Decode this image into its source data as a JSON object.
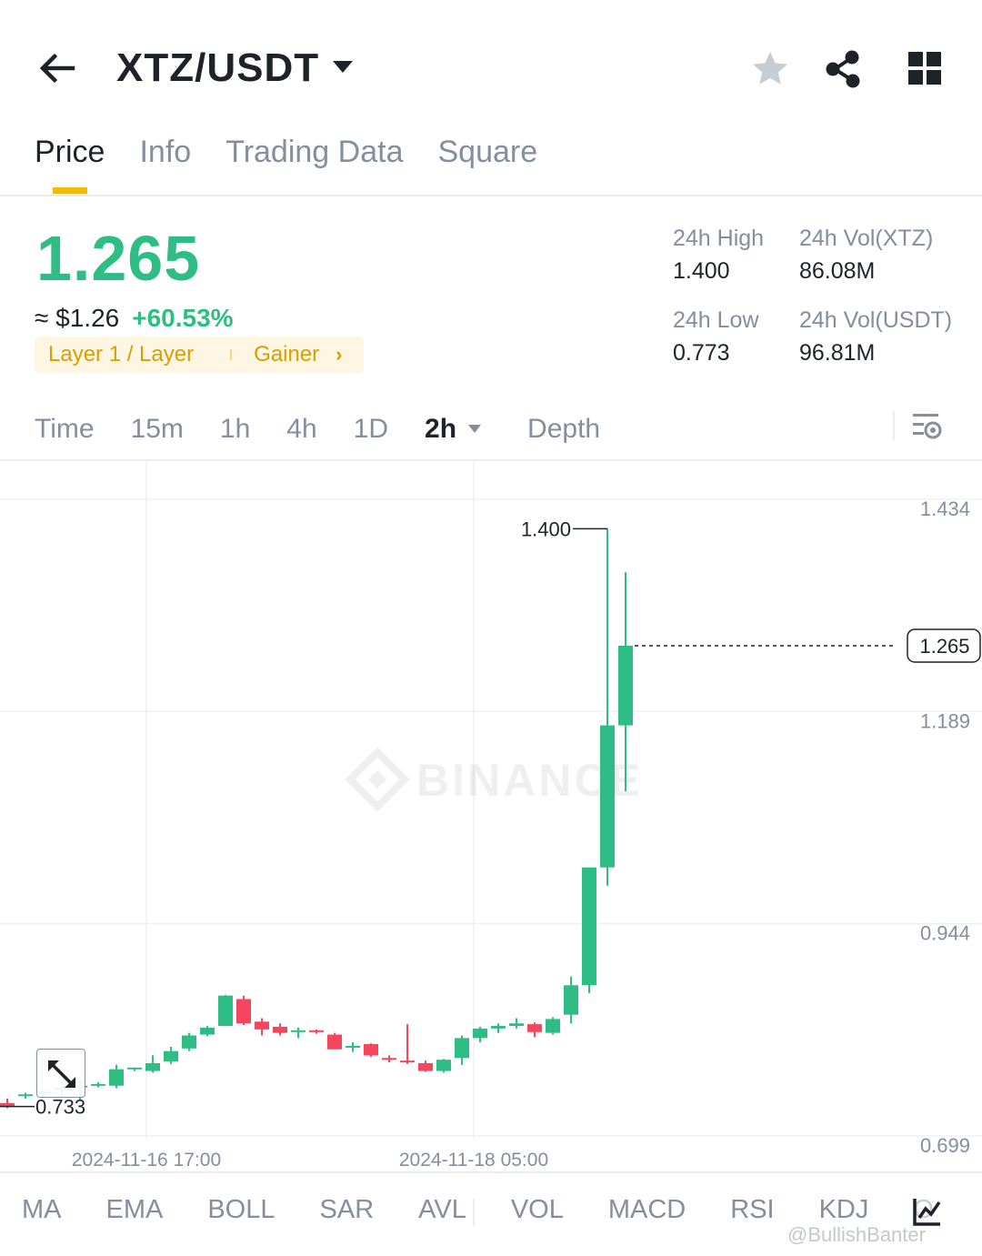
{
  "header": {
    "pair": "XTZ/USDT"
  },
  "tabs": [
    {
      "label": "Price"
    },
    {
      "label": "Info"
    },
    {
      "label": "Trading Data"
    },
    {
      "label": "Square"
    }
  ],
  "ticker": {
    "last_price": "1.265",
    "fiat_price": "≈ $1.26",
    "change": "+60.53%",
    "tag": "Layer 1 / Layer",
    "tag2": "Gainer",
    "high_label": "24h High",
    "high_value": "1.400",
    "low_label": "24h Low",
    "low_value": "0.773",
    "vol_base_label": "24h Vol(XTZ)",
    "vol_base_value": "86.08M",
    "vol_quote_label": "24h Vol(USDT)",
    "vol_quote_value": "96.81M"
  },
  "intervals": [
    {
      "label": "Time"
    },
    {
      "label": "15m"
    },
    {
      "label": "1h"
    },
    {
      "label": "4h"
    },
    {
      "label": "1D"
    },
    {
      "label": "2h",
      "active": true
    },
    {
      "label": "Depth"
    }
  ],
  "indicators": [
    "MA",
    "EMA",
    "BOLL",
    "SAR",
    "AVL",
    "VOL",
    "MACD",
    "RSI",
    "KDJ",
    "O"
  ],
  "watermark": {
    "brand": "BINANCE",
    "handle": "@BullishBanter"
  },
  "colors": {
    "up": "#2ebd85",
    "down": "#f6465d",
    "accent": "#f0b90b",
    "muted": "#848e9c"
  },
  "chart_data": {
    "type": "candlestick",
    "y_ticks": [
      "1.434",
      "1.189",
      "0.944",
      "0.699"
    ],
    "x_ticks": [
      "2024-11-16 17:00",
      "2024-11-18 05:00"
    ],
    "ylim": [
      0.699,
      1.434
    ],
    "current_price": "1.265",
    "max_label": "1.400",
    "min_label": "0.733",
    "candles": [
      {
        "o": 0.737,
        "h": 0.742,
        "l": 0.731,
        "c": 0.733
      },
      {
        "o": 0.745,
        "h": 0.749,
        "l": 0.742,
        "c": 0.747
      },
      {
        "o": 0.748,
        "h": 0.753,
        "l": 0.744,
        "c": 0.751
      },
      {
        "o": 0.752,
        "h": 0.756,
        "l": 0.744,
        "c": 0.755
      },
      {
        "o": 0.756,
        "h": 0.763,
        "l": 0.741,
        "c": 0.757
      },
      {
        "o": 0.759,
        "h": 0.761,
        "l": 0.755,
        "c": 0.759
      },
      {
        "o": 0.757,
        "h": 0.781,
        "l": 0.754,
        "c": 0.776
      },
      {
        "o": 0.776,
        "h": 0.778,
        "l": 0.774,
        "c": 0.778
      },
      {
        "o": 0.774,
        "h": 0.792,
        "l": 0.772,
        "c": 0.783
      },
      {
        "o": 0.785,
        "h": 0.802,
        "l": 0.782,
        "c": 0.797
      },
      {
        "o": 0.8,
        "h": 0.818,
        "l": 0.797,
        "c": 0.815
      },
      {
        "o": 0.816,
        "h": 0.826,
        "l": 0.814,
        "c": 0.824
      },
      {
        "o": 0.826,
        "h": 0.862,
        "l": 0.826,
        "c": 0.861
      },
      {
        "o": 0.857,
        "h": 0.861,
        "l": 0.827,
        "c": 0.829
      },
      {
        "o": 0.831,
        "h": 0.835,
        "l": 0.815,
        "c": 0.822
      },
      {
        "o": 0.825,
        "h": 0.829,
        "l": 0.815,
        "c": 0.818
      },
      {
        "o": 0.82,
        "h": 0.824,
        "l": 0.812,
        "c": 0.821
      },
      {
        "o": 0.821,
        "h": 0.822,
        "l": 0.817,
        "c": 0.819
      },
      {
        "o": 0.816,
        "h": 0.818,
        "l": 0.799,
        "c": 0.799
      },
      {
        "o": 0.802,
        "h": 0.807,
        "l": 0.796,
        "c": 0.803
      },
      {
        "o": 0.805,
        "h": 0.806,
        "l": 0.79,
        "c": 0.792
      },
      {
        "o": 0.789,
        "h": 0.792,
        "l": 0.784,
        "c": 0.787
      },
      {
        "o": 0.786,
        "h": 0.828,
        "l": 0.782,
        "c": 0.784
      },
      {
        "o": 0.783,
        "h": 0.786,
        "l": 0.773,
        "c": 0.774
      },
      {
        "o": 0.774,
        "h": 0.788,
        "l": 0.772,
        "c": 0.787
      },
      {
        "o": 0.789,
        "h": 0.815,
        "l": 0.781,
        "c": 0.812
      },
      {
        "o": 0.812,
        "h": 0.825,
        "l": 0.807,
        "c": 0.823
      },
      {
        "o": 0.823,
        "h": 0.829,
        "l": 0.818,
        "c": 0.826
      },
      {
        "o": 0.826,
        "h": 0.835,
        "l": 0.823,
        "c": 0.829
      },
      {
        "o": 0.828,
        "h": 0.83,
        "l": 0.813,
        "c": 0.819
      },
      {
        "o": 0.818,
        "h": 0.836,
        "l": 0.816,
        "c": 0.834
      },
      {
        "o": 0.839,
        "h": 0.883,
        "l": 0.829,
        "c": 0.873
      },
      {
        "o": 0.873,
        "h": 1.006,
        "l": 0.864,
        "c": 1.009
      },
      {
        "o": 1.009,
        "h": 1.4,
        "l": 0.988,
        "c": 1.173
      },
      {
        "o": 1.173,
        "h": 1.35,
        "l": 1.097,
        "c": 1.265
      }
    ]
  }
}
